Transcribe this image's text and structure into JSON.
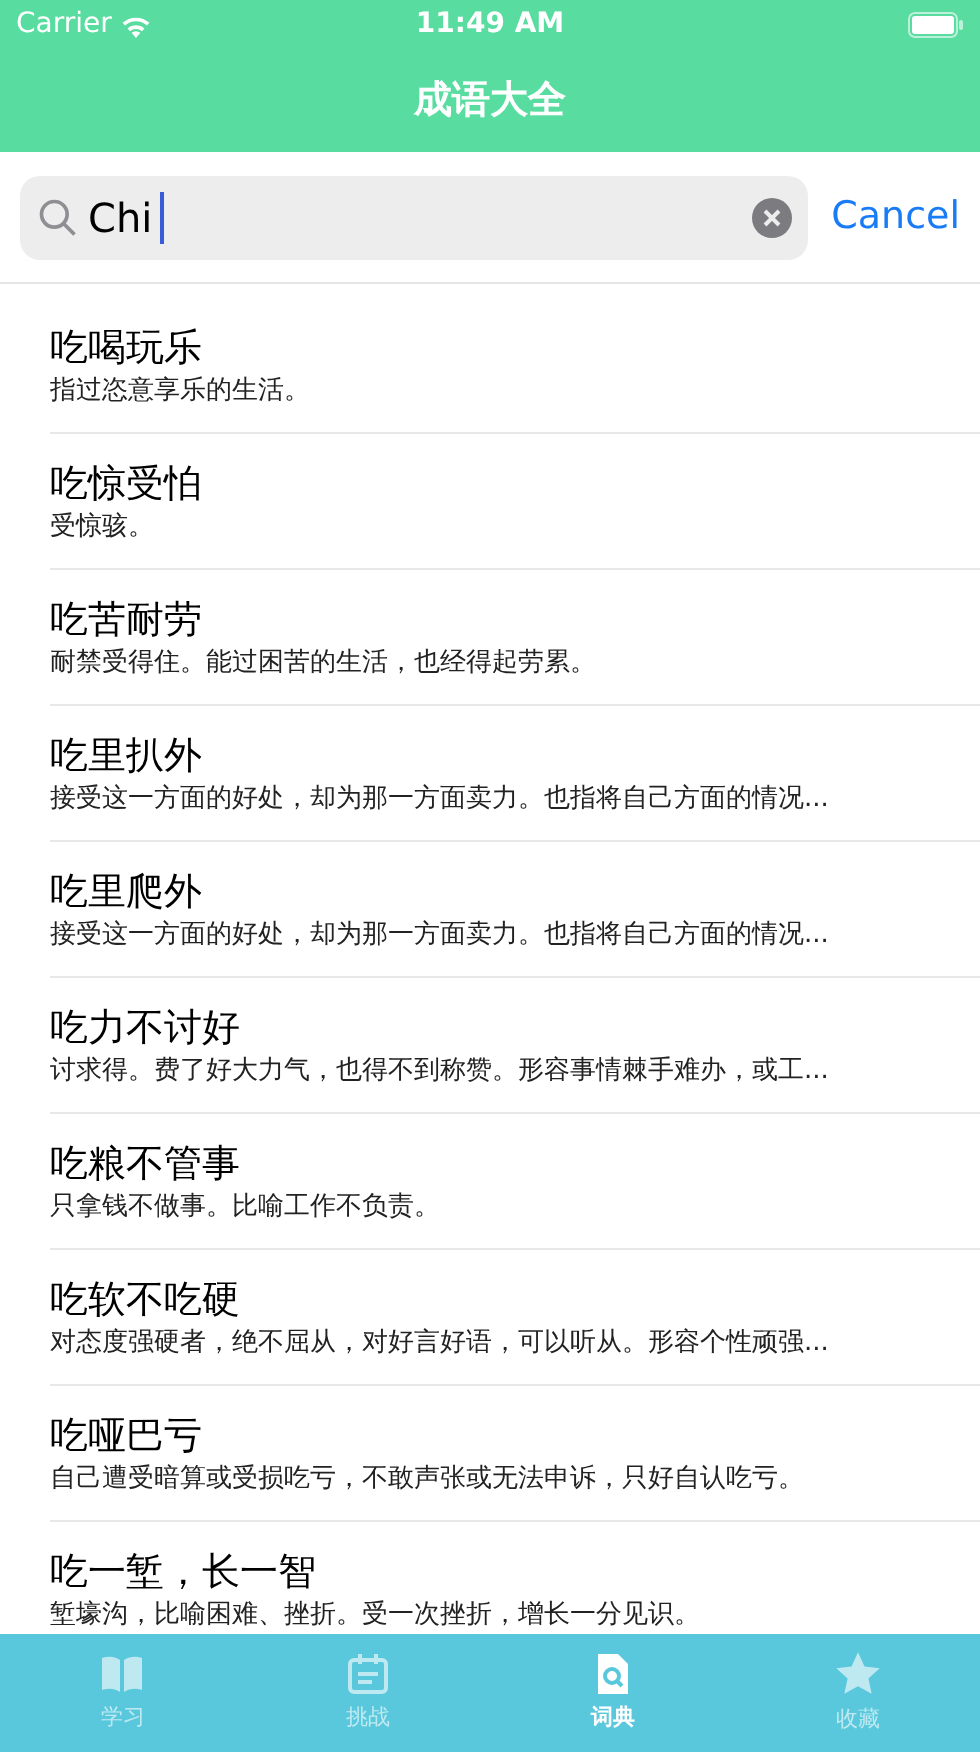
{
  "status_bar": {
    "carrier": "Carrier",
    "time": "11:49 AM"
  },
  "nav": {
    "title": "成语大全"
  },
  "search": {
    "value": "Chi",
    "cancel": "Cancel"
  },
  "results": [
    {
      "title": "吃喝玩乐",
      "meaning": "指过恣意享乐的生活。"
    },
    {
      "title": "吃惊受怕",
      "meaning": "受惊骇。"
    },
    {
      "title": "吃苦耐劳",
      "meaning": "耐禁受得住。能过困苦的生活，也经得起劳累。"
    },
    {
      "title": "吃里扒外",
      "meaning": "接受这一方面的好处，却为那一方面卖力。也指将自己方面的情况..."
    },
    {
      "title": "吃里爬外",
      "meaning": "接受这一方面的好处，却为那一方面卖力。也指将自己方面的情况..."
    },
    {
      "title": "吃力不讨好",
      "meaning": "讨求得。费了好大力气，也得不到称赞。形容事情棘手难办，或工..."
    },
    {
      "title": "吃粮不管事",
      "meaning": "只拿钱不做事。比喻工作不负责。"
    },
    {
      "title": "吃软不吃硬",
      "meaning": "对态度强硬者，绝不屈从，对好言好语，可以听从。形容个性顽强..."
    },
    {
      "title": "吃哑巴亏",
      "meaning": "自己遭受暗算或受损吃亏，不敢声张或无法申诉，只好自认吃亏。"
    },
    {
      "title": "吃一堑，长一智",
      "meaning": "堑壕沟，比喻困难、挫折。受一次挫折，增长一分见识。"
    }
  ],
  "tabs": [
    {
      "label": "学习",
      "kind": "book",
      "selected": false
    },
    {
      "label": "挑战",
      "kind": "calendar",
      "selected": false
    },
    {
      "label": "词典",
      "kind": "search",
      "selected": true
    },
    {
      "label": "收藏",
      "kind": "star",
      "selected": false
    }
  ]
}
